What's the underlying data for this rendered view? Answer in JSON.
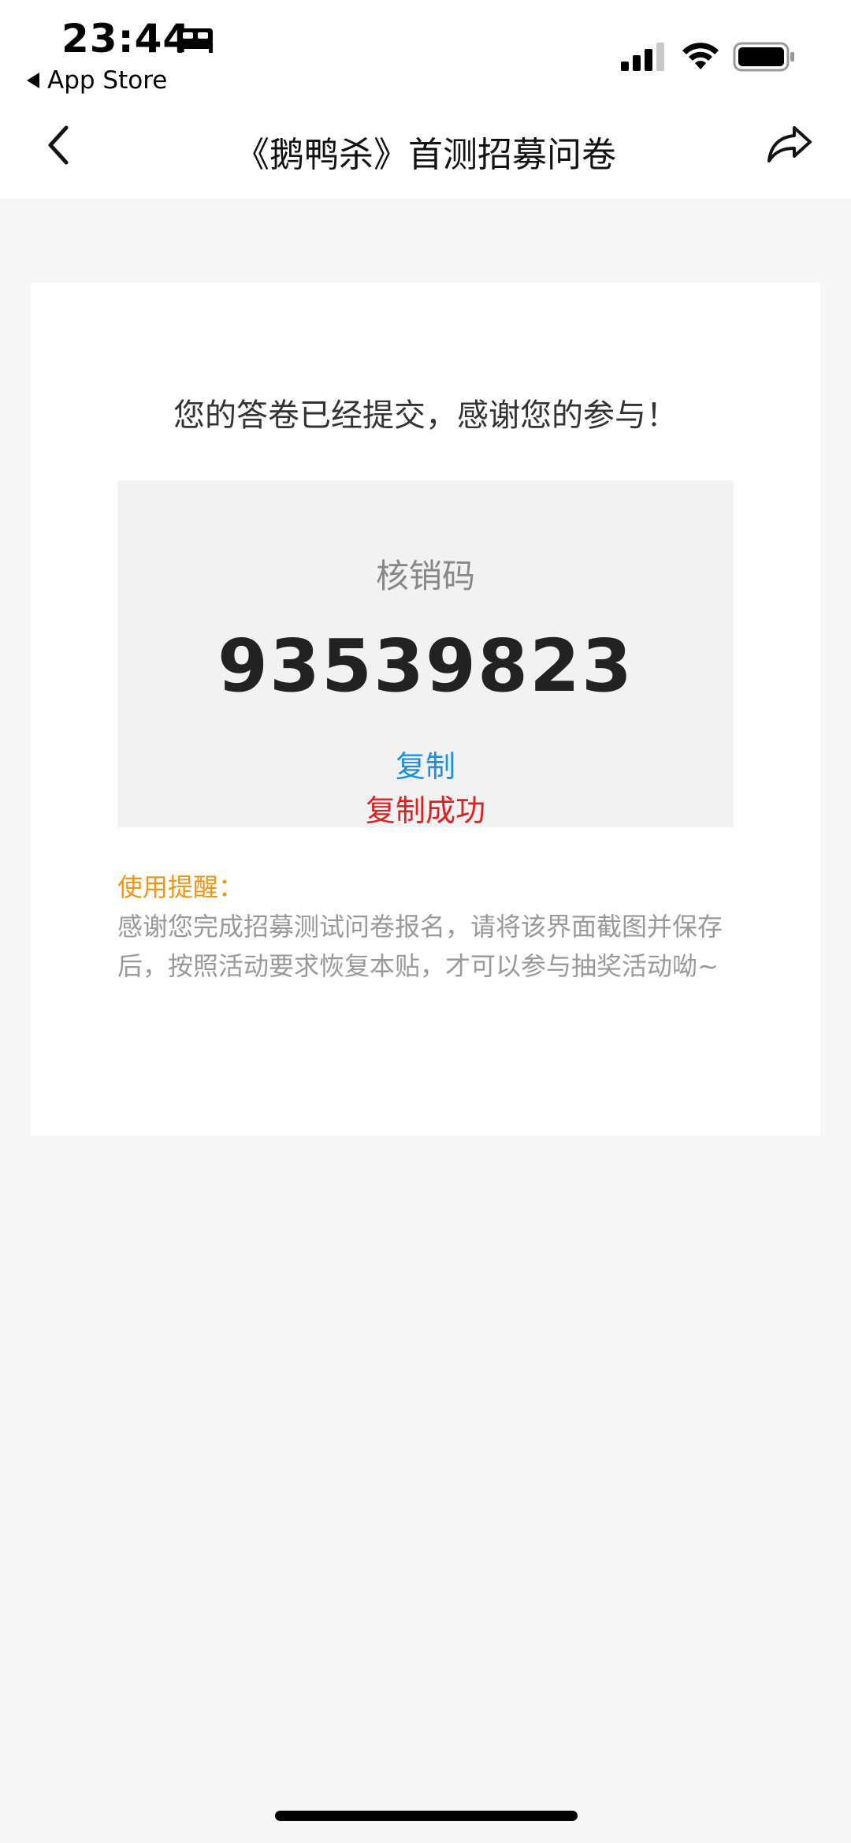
{
  "status_bar": {
    "time": "23:44",
    "back_app_label": "App Store",
    "icons": [
      "bed-icon",
      "signal-icon",
      "wifi-icon",
      "battery-icon"
    ]
  },
  "nav": {
    "title": "《鹅鸭杀》首测招募问卷",
    "back_icon": "chevron-left-icon",
    "share_icon": "share-icon"
  },
  "card": {
    "message": "您的答卷已经提交，感谢您的参与！",
    "code_label": "核销码",
    "code_value": "93539823",
    "copy_label": "复制",
    "copy_success": "复制成功",
    "tip_title": "使用提醒：",
    "tip_body": "感谢您完成招募测试问卷报名，请将该界面截图并保存后，按照活动要求恢复本贴，才可以参与抽奖活动呦~"
  },
  "colors": {
    "background": "#f6f6f6",
    "card": "#ffffff",
    "code_box": "#f2f2f2",
    "link_blue": "#1a8fe3",
    "success_red": "#e02020",
    "tip_orange": "#f29516"
  }
}
